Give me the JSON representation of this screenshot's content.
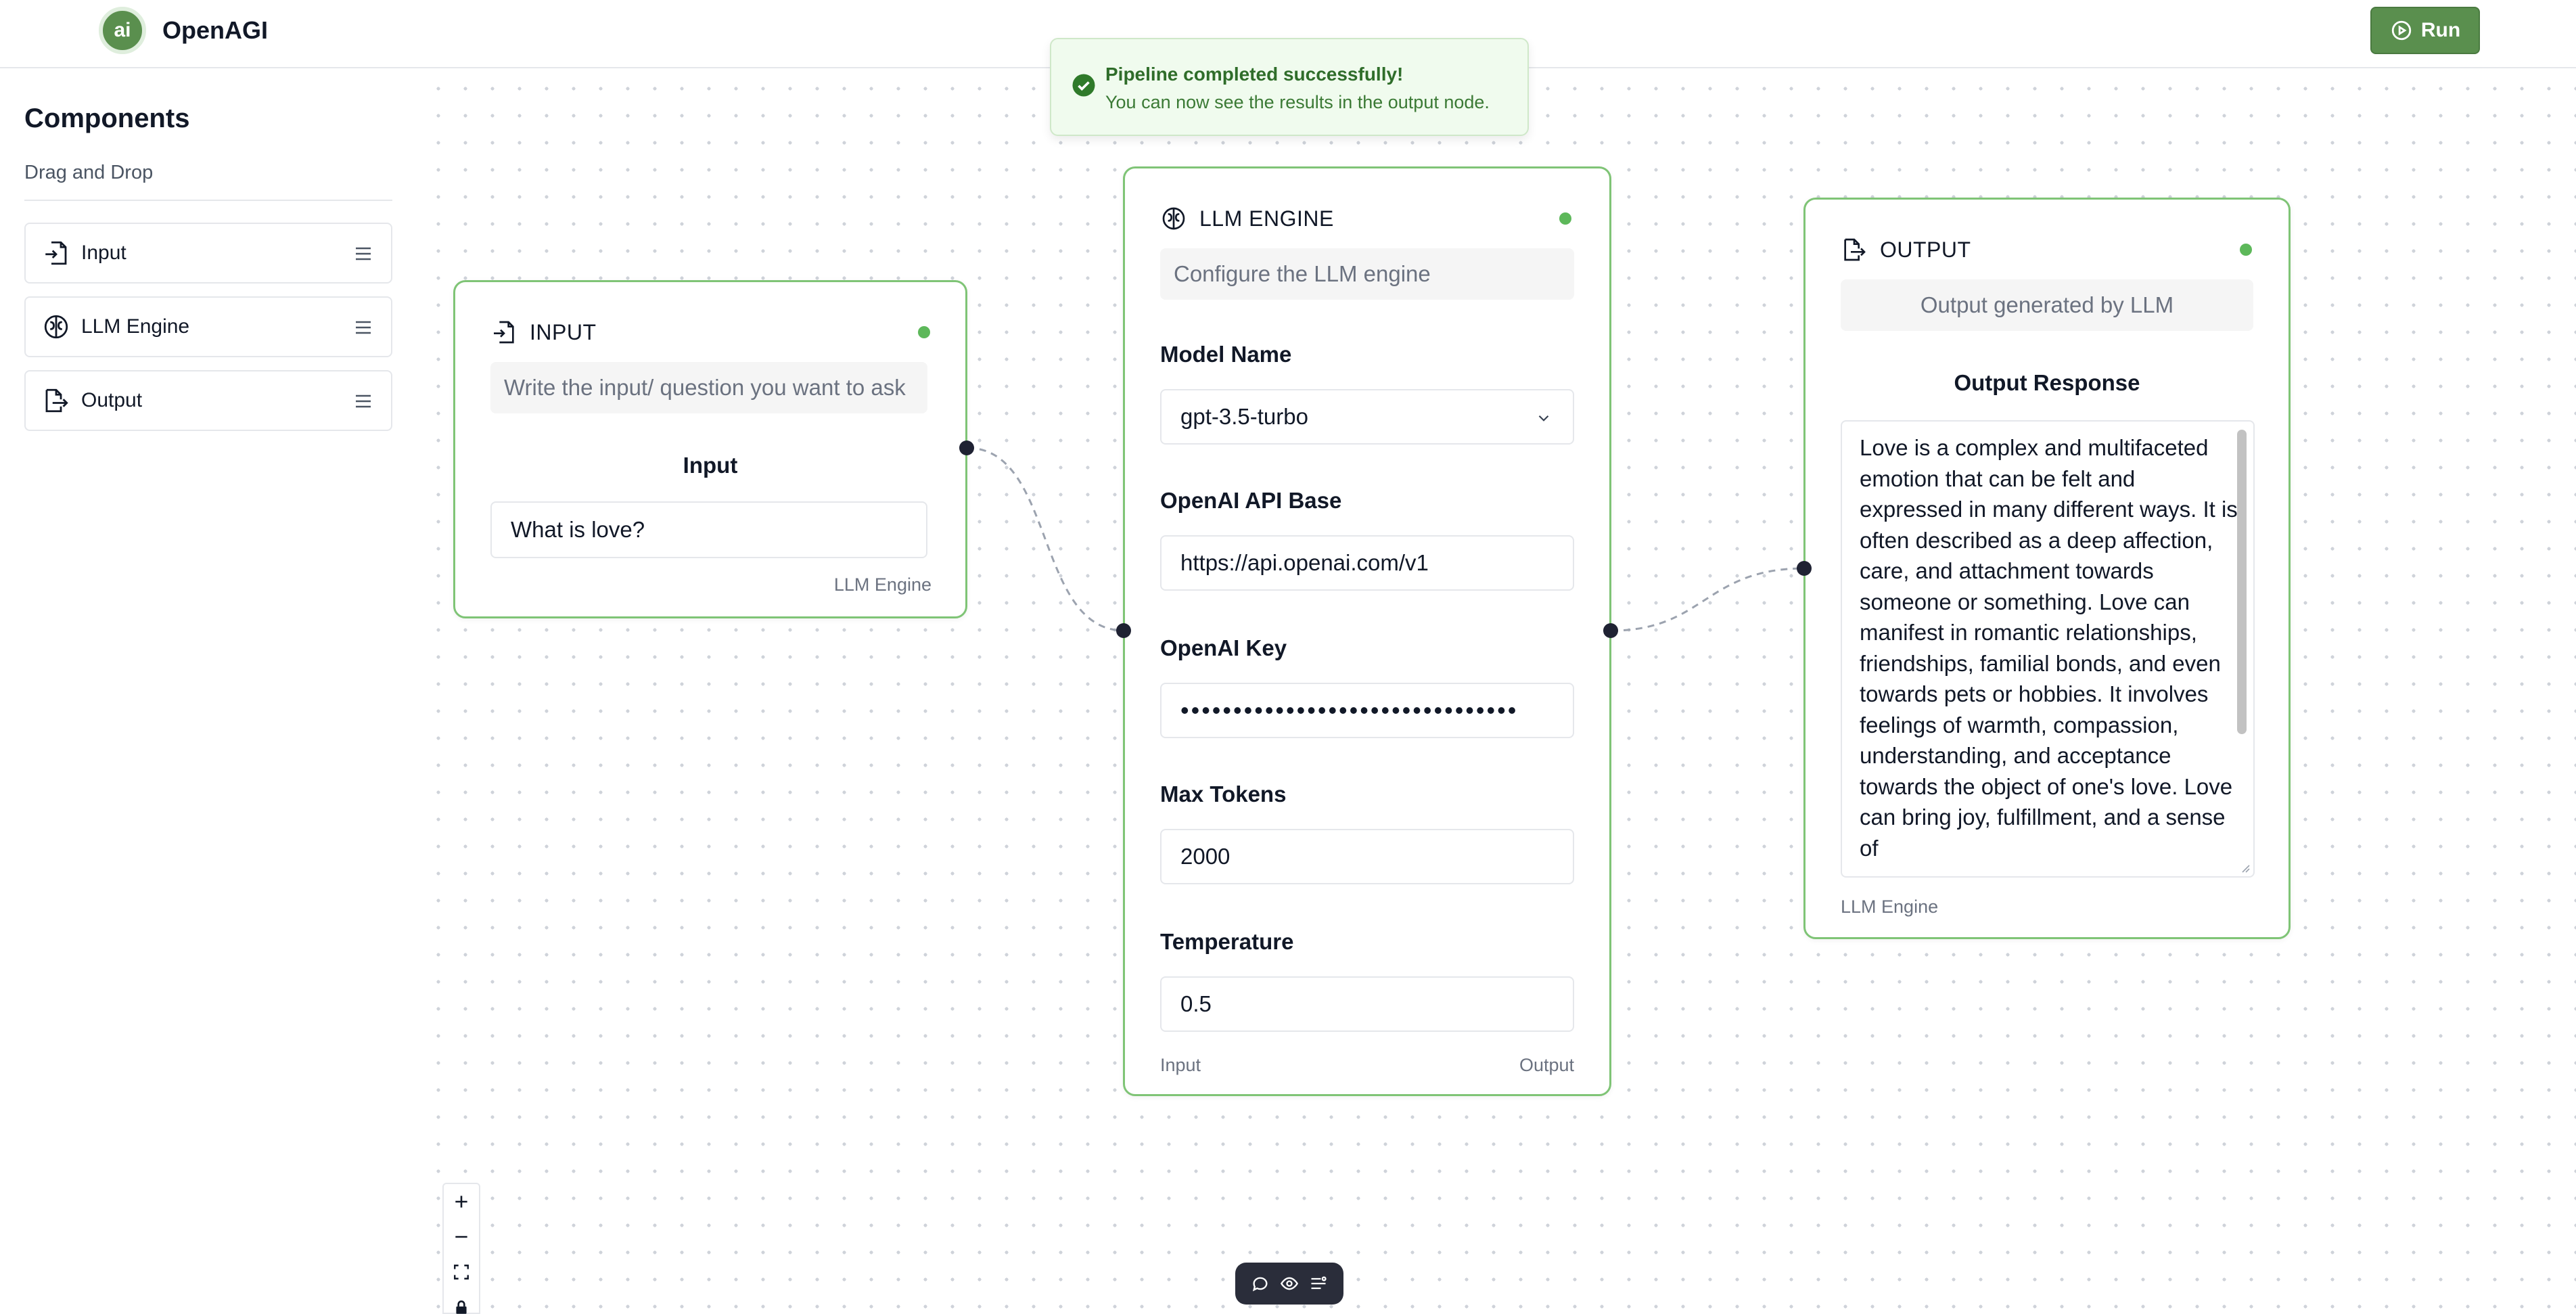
{
  "app": {
    "brand": "OpenAGI",
    "logo_text": "ai",
    "run_label": "Run"
  },
  "sidebar": {
    "title": "Components",
    "subtitle": "Drag and Drop",
    "items": [
      {
        "label": "Input",
        "icon": "file-input-icon"
      },
      {
        "label": "LLM Engine",
        "icon": "brain-icon"
      },
      {
        "label": "Output",
        "icon": "file-output-icon"
      }
    ]
  },
  "toast": {
    "title": "Pipeline completed successfully!",
    "message": "You can now see the results in the output node."
  },
  "input_node": {
    "title": "INPUT",
    "description": "Write the input/ question you want to ask",
    "field_label": "Input",
    "field_value": "What is love?",
    "footer": "LLM Engine"
  },
  "llm_node": {
    "title": "LLM ENGINE",
    "description": "Configure the LLM engine",
    "model_label": "Model Name",
    "model_value": "gpt-3.5-turbo",
    "api_base_label": "OpenAI API Base",
    "api_base_value": "https://api.openai.com/v1",
    "key_label": "OpenAI Key",
    "key_value": "••••••••••••••••••••••••••••••••",
    "max_tokens_label": "Max Tokens",
    "max_tokens_value": "2000",
    "temperature_label": "Temperature",
    "temperature_value": "0.5",
    "footer_left": "Input",
    "footer_right": "Output"
  },
  "output_node": {
    "title": "OUTPUT",
    "description": "Output generated by LLM",
    "response_label": "Output Response",
    "response_text": "Love is a complex and multifaceted emotion that can be felt and expressed in many different ways. It is often described as a deep affection, care, and attachment towards someone or something. Love can manifest in romantic relationships, friendships, familial bonds, and even towards pets or hobbies. It involves feelings of warmth, compassion, understanding, and acceptance towards the object of one's love. Love can bring joy, fulfillment, and a sense of",
    "footer": "LLM Engine"
  },
  "colors": {
    "accent": "#5a8f4e",
    "node_border": "#7fc476",
    "status": "#5db85a",
    "handle": "#1f2233"
  }
}
